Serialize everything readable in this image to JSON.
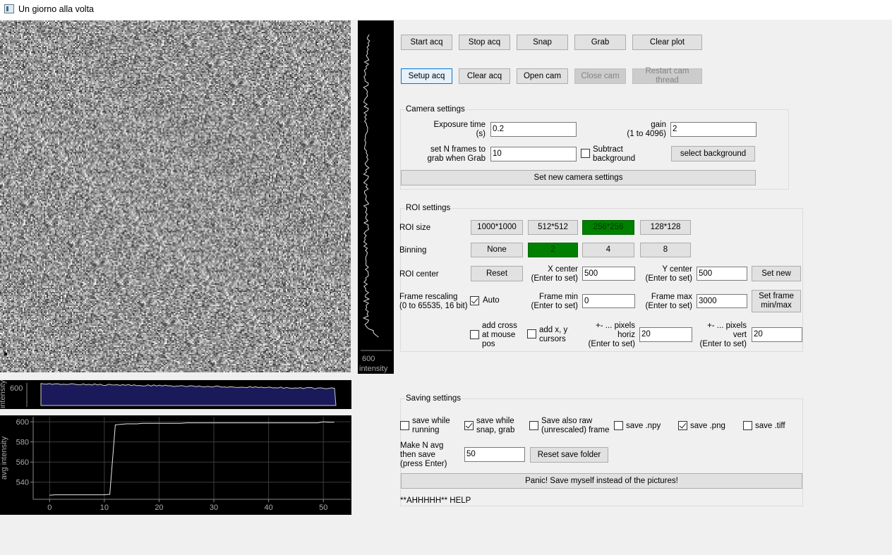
{
  "window": {
    "title": "Un giorno alla volta"
  },
  "acq_buttons_row1": [
    "Start acq",
    "Stop acq",
    "Snap",
    "Grab",
    "Clear plot"
  ],
  "acq_buttons_row2": [
    "Setup acq",
    "Clear acq",
    "Open cam",
    "Close cam",
    "Restart cam thread"
  ],
  "camera": {
    "title": "Camera settings",
    "exposure_label": "Exposure time\n(s)",
    "exposure_value": "0.2",
    "gain_label": "gain\n(1 to 4096)",
    "gain_value": "2",
    "nframes_label": "set N frames to\ngrab when Grab",
    "nframes_value": "10",
    "subtract_label": "Subtract\nbackground",
    "select_bg": "select background",
    "set_new": "Set new camera settings"
  },
  "roi": {
    "title": "ROI settings",
    "size_label": "ROI size",
    "sizes": [
      "1000*1000",
      "512*512",
      "256*256",
      "128*128"
    ],
    "binning_label": "Binning",
    "binnings": [
      "None",
      "2",
      "4",
      "8"
    ],
    "center_label": "ROI center",
    "reset": "Reset",
    "xcenter_label": "X center\n(Enter to set)",
    "xcenter_value": "500",
    "ycenter_label": "Y center\n(Enter to set)",
    "ycenter_value": "500",
    "set_new": "Set new",
    "rescale_label": "Frame rescaling\n(0 to 65535, 16 bit)",
    "auto_label": "Auto",
    "fmin_label": "Frame min\n(Enter to set)",
    "fmin_value": "0",
    "fmax_label": "Frame max\n(Enter to set)",
    "fmax_value": "3000",
    "set_minmax": "Set frame\nmin/max",
    "cross_label": "add cross\nat mouse\npos",
    "cursors_label": "add x, y\ncursors",
    "horiz_label": "+- ... pixels\nhoriz\n(Enter to set)",
    "horiz_value": "20",
    "vert_label": "+- ... pixels\nvert\n(Enter to set)",
    "vert_value": "20"
  },
  "saving": {
    "title": "Saving settings",
    "save_running": "save while\nrunning",
    "save_snap": "save while\nsnap, grab",
    "save_raw": "Save also raw\n(unrescaled) frame",
    "save_npy": "save .npy",
    "save_png": "save .png",
    "save_tiff": "save .tiff",
    "navg_label": "Make N avg\nthen save\n(press Enter)",
    "navg_value": "50",
    "reset_folder": "Reset save folder",
    "panic": "Panic! Save myself instead of the pictures!",
    "help": "**AHHHHH** HELP"
  },
  "vplot": {
    "tick": "600",
    "axis_label": "intensity"
  },
  "hplot": {
    "tick": "600",
    "axis_label": "intensity"
  },
  "colors": {
    "active_green": "#008000",
    "plot_fill": "#1a1a5a"
  },
  "chart_data": {
    "type": "line",
    "ylabel": "avg intensity",
    "xlabel": "",
    "xlim": [
      -3,
      55
    ],
    "ylim": [
      523,
      605
    ],
    "xticks": [
      "0",
      "10",
      "20",
      "30",
      "40",
      "50"
    ],
    "yticks": [
      "540",
      "560",
      "580",
      "600"
    ],
    "x": [
      0,
      1,
      2,
      3,
      4,
      5,
      6,
      7,
      8,
      9,
      10,
      11,
      12,
      13,
      14,
      15,
      16,
      17,
      18,
      19,
      20,
      21,
      22,
      23,
      24,
      25,
      26,
      27,
      28,
      29,
      30,
      31,
      32,
      33,
      34,
      35,
      36,
      37,
      38,
      39,
      40,
      41,
      42,
      43,
      44,
      45,
      46,
      47,
      48,
      49,
      50,
      51,
      52
    ],
    "y": [
      527,
      527.5,
      527.5,
      527.5,
      527.5,
      527.5,
      527.5,
      527.5,
      527.5,
      527.5,
      527.5,
      528,
      597,
      597.5,
      598,
      598,
      598,
      598.5,
      598.5,
      598.5,
      598.5,
      598.5,
      598.5,
      598.5,
      598.5,
      599,
      599,
      599,
      599,
      599,
      599,
      599,
      599,
      599,
      599,
      599,
      599,
      599,
      599,
      599,
      599,
      599,
      599,
      599,
      599,
      599,
      599,
      599,
      599,
      599,
      600,
      599.5,
      599.5
    ]
  }
}
